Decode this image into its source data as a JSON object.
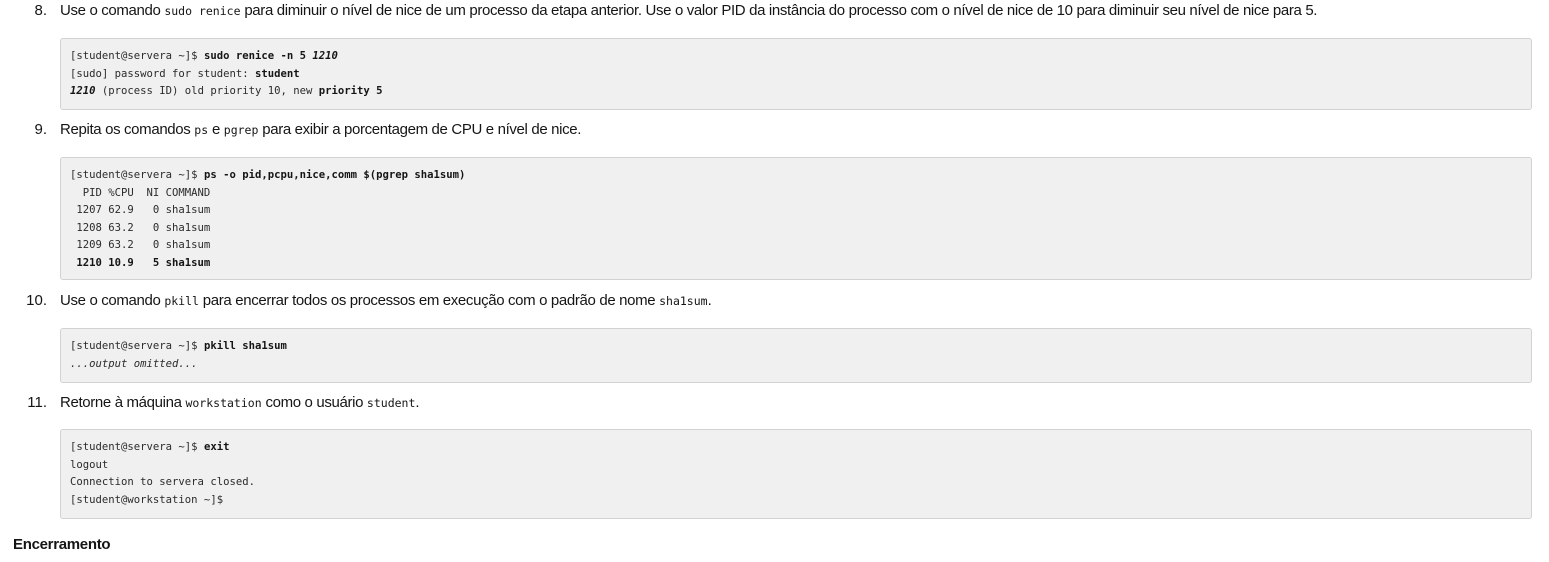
{
  "steps": [
    {
      "number": "8.",
      "text_parts": [
        "Use o comando ",
        "sudo renice",
        " para diminuir o nível de nice de um processo da etapa anterior. Use o valor PID da instância do processo com o nível de nice de 10 para diminuir seu nível de nice para 5."
      ],
      "terminal": {
        "line1_prompt": "[student@servera ~]$ ",
        "line1_cmd": "sudo renice -n 5 ",
        "line1_pid": "1210",
        "line2_prefix": "[sudo] password for student: ",
        "line2_pw": "student",
        "line3_pid": "1210",
        "line3_mid": " (process ID) old priority 10, new ",
        "line3_end": "priority 5"
      }
    },
    {
      "number": "9.",
      "text_parts": [
        "Repita os comandos ",
        "ps",
        " e ",
        "pgrep",
        " para exibir a porcentagem de CPU e nível de nice."
      ],
      "terminal": {
        "prompt": "[student@servera ~]$ ",
        "cmd": "ps -o pid,pcpu,nice,comm $(pgrep sha1sum)",
        "header": "  PID %CPU  NI COMMAND",
        "rows": [
          " 1207 62.9   0 sha1sum",
          " 1208 63.2   0 sha1sum",
          " 1209 63.2   0 sha1sum"
        ],
        "highlight_row": " 1210 10.9   5 sha1sum"
      }
    },
    {
      "number": "10.",
      "text_parts": [
        "Use o comando ",
        "pkill",
        " para encerrar todos os processos em execução com o padrão de nome ",
        "sha1sum",
        "."
      ],
      "terminal": {
        "prompt": "[student@servera ~]$ ",
        "cmd": "pkill sha1sum",
        "omitted": "...output omitted..."
      }
    },
    {
      "number": "11.",
      "text_parts": [
        "Retorne à máquina ",
        "workstation",
        " como o usuário ",
        "student",
        "."
      ],
      "terminal": {
        "prompt": "[student@servera ~]$ ",
        "cmd": "exit",
        "line2": "logout",
        "line3": "Connection to servera closed.",
        "line4": "[student@workstation ~]$"
      }
    }
  ],
  "footer": {
    "heading": "Encerramento"
  }
}
